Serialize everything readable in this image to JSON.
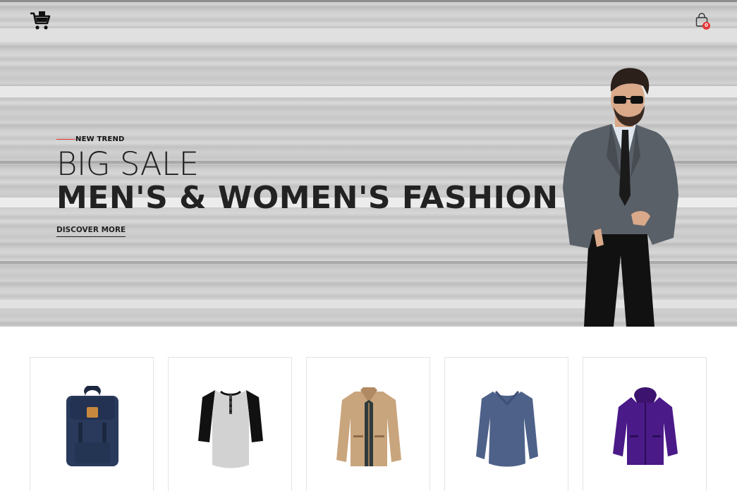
{
  "header": {
    "logo_icon": "shopping-cart-icon",
    "bag_icon": "shopping-bag-icon",
    "bag_count": "0"
  },
  "hero": {
    "kicker": "NEW TREND",
    "title_light": "BIG SALE",
    "title_bold": "MEN'S & WOMEN'S FASHION",
    "cta": "DISCOVER MORE",
    "accent_color": "#e53637",
    "background_color": "#c9c9c9"
  },
  "products": [
    {
      "icon": "backpack-icon",
      "color": "#2a3a5c"
    },
    {
      "icon": "henley-shirt-icon",
      "color": "#d0d0d0"
    },
    {
      "icon": "jacket-icon",
      "color": "#c9a57d"
    },
    {
      "icon": "sweater-icon",
      "color": "#4e6189"
    },
    {
      "icon": "hooded-jacket-icon",
      "color": "#4a1a88"
    }
  ]
}
